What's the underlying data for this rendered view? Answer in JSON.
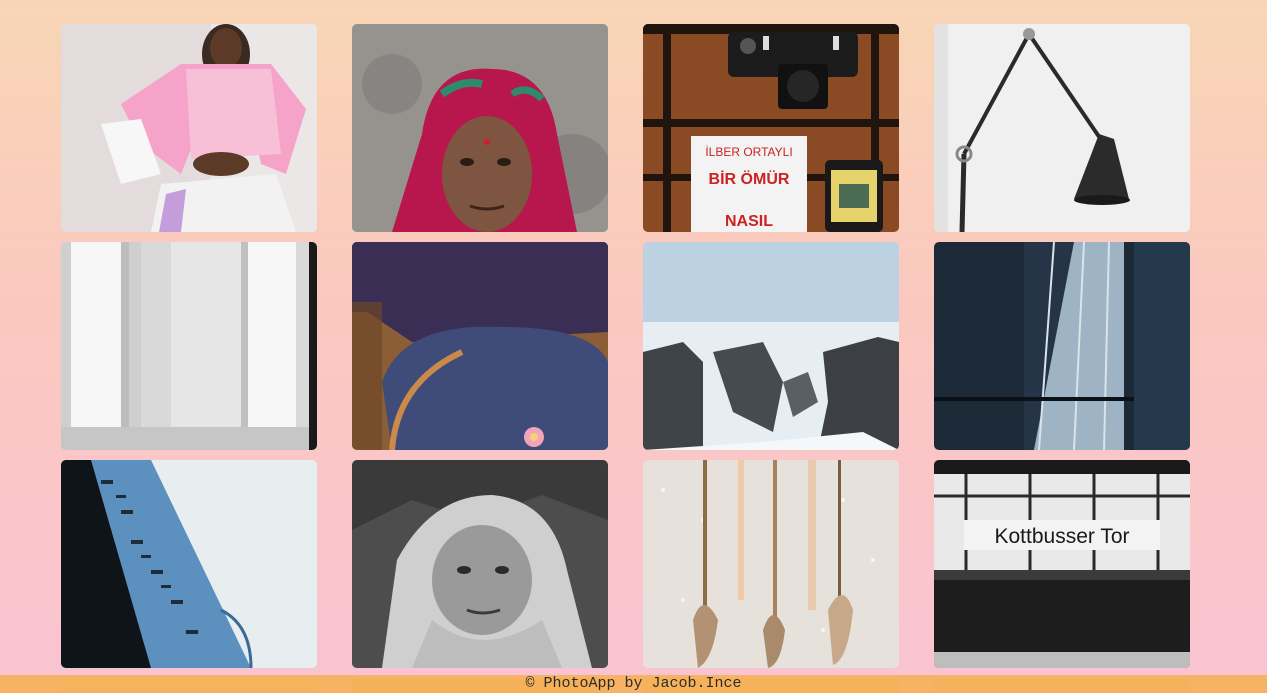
{
  "app": {
    "footer_text": "© PhotoApp by Jacob.Ince"
  },
  "photos": [
    {
      "name": "photo-woman-pink-jacket",
      "bg": "#e4dcdc"
    },
    {
      "name": "photo-elderly-woman-red-headscarf",
      "bg": "#8e8a86"
    },
    {
      "name": "photo-camera-and-book",
      "bg": "#8a4a23",
      "book_title_1": "İLBER ORTAYLI",
      "book_title_2": "BİR ÖMÜR",
      "book_title_3": "NASIL"
    },
    {
      "name": "photo-black-desk-lamp",
      "bg": "#f0f0f0"
    },
    {
      "name": "photo-white-windows",
      "bg": "#d9d9d9"
    },
    {
      "name": "photo-chair-pink-flower",
      "bg": "#3a2e54"
    },
    {
      "name": "photo-snowy-cliffs",
      "bg": "#bcd1e2"
    },
    {
      "name": "photo-glass-building-dark",
      "bg": "#1c2a38"
    },
    {
      "name": "photo-blue-glass-facade",
      "bg": "#5c90bf"
    },
    {
      "name": "photo-elderly-woman-bw",
      "bg": "#3a3a3a"
    },
    {
      "name": "photo-feather-dreamcatcher",
      "bg": "#e7e1dc"
    },
    {
      "name": "photo-kottbusser-tor-station",
      "bg": "#2a2a2a",
      "sign_text": "Kottbusser Tor"
    }
  ],
  "peek_colors": [
    "#e9c18a",
    "#d2a24a",
    "#e6b25c",
    "#e4ae60"
  ]
}
